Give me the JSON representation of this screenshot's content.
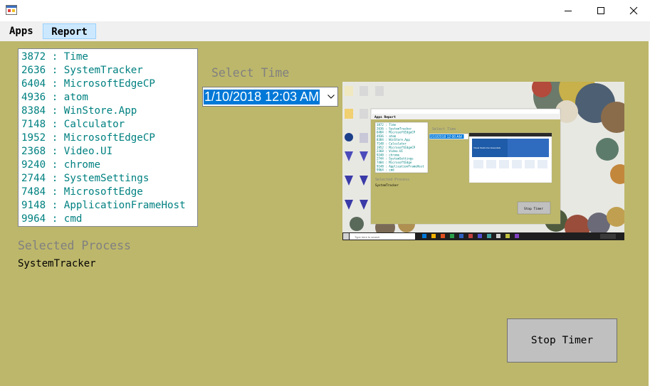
{
  "window": {
    "app_icon": "winforms-app-icon",
    "controls": [
      "minimize-icon",
      "maximize-icon",
      "close-icon"
    ]
  },
  "menu": {
    "apps_label": "Apps",
    "report_label": "Report"
  },
  "process_list": {
    "items": [
      "3872 : Time",
      "2636 : SystemTracker",
      "6404 : MicrosoftEdgeCP",
      "4936 : atom",
      "8384 : WinStore.App",
      "7148 : Calculator",
      "1952 : MicrosoftEdgeCP",
      "2368 : Video.UI",
      "9240 : chrome",
      "2744 : SystemSettings",
      "7484 : MicrosoftEdge",
      "9148 : ApplicationFrameHost",
      "9964 : cmd"
    ]
  },
  "selected_process": {
    "label": "Selected Process",
    "value": "SystemTracker"
  },
  "time_select": {
    "label": "Select Time",
    "value": "1/10/2018 12:03 AM"
  },
  "screenshot_preview": {
    "inner": {
      "process_items": [
        "3872 : Time",
        "2636 : SystemTracker",
        "6404 : MicrosoftEdgeCP",
        "4936 : atom",
        "8384 : WinStore.App",
        "7148 : Calculator",
        "1952 : MicrosoftEdgeCP",
        "2368 : Video.UI",
        "9240 : chrome",
        "2744 : SystemSettings",
        "7484 : MicrosoftEdge",
        "9148 : ApplicationFrameHost",
        "9964 : cmd"
      ],
      "select_time_label": "Select Time",
      "time_value": "1/10/2018 12:00 AM",
      "selected_label": "Selected Process",
      "selected_value": "SystemTracker",
      "stop_button": "Stop Timer",
      "search_placeholder": "Type here to search"
    }
  },
  "stop_button_label": "Stop Timer",
  "colors": {
    "client_background": "#bdb76b",
    "list_text": "#008080",
    "label_text": "#808080",
    "selection": "#0078d7",
    "menu_highlight": "#cce8ff"
  }
}
